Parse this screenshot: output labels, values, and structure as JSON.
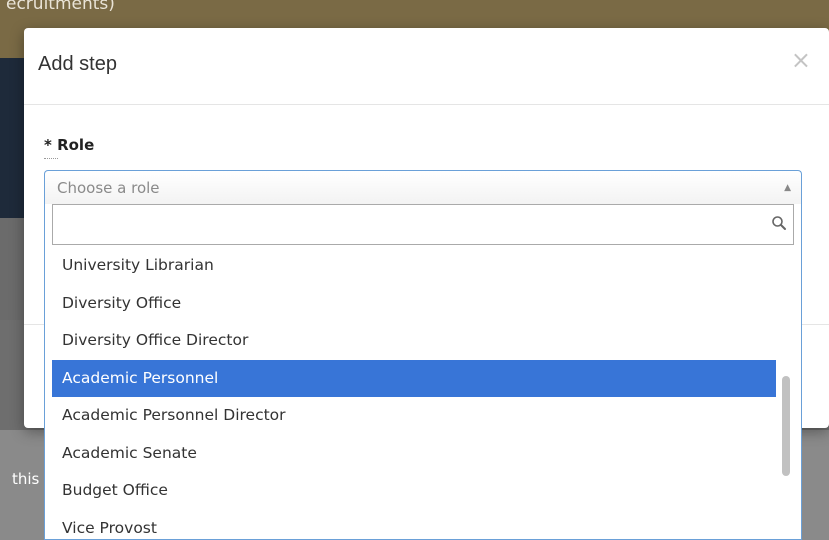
{
  "background": {
    "title_fragment": "ecruitments)",
    "side_text": "this"
  },
  "modal": {
    "title": "Add step",
    "close_symbol": "×",
    "field_label": "* Role",
    "select": {
      "placeholder": "Choose a role",
      "arrow_symbol": "▲",
      "search_placeholder": "",
      "search_icon": "search-icon",
      "options": [
        "University Librarian",
        "Diversity Office",
        "Diversity Office Director",
        "Academic Personnel",
        "Academic Personnel Director",
        "Academic Senate",
        "Budget Office",
        "Vice Provost"
      ],
      "highlighted_option": "Academic Personnel"
    }
  },
  "colors": {
    "highlight": "#3875d7",
    "focus_border": "#6aa0d8"
  }
}
